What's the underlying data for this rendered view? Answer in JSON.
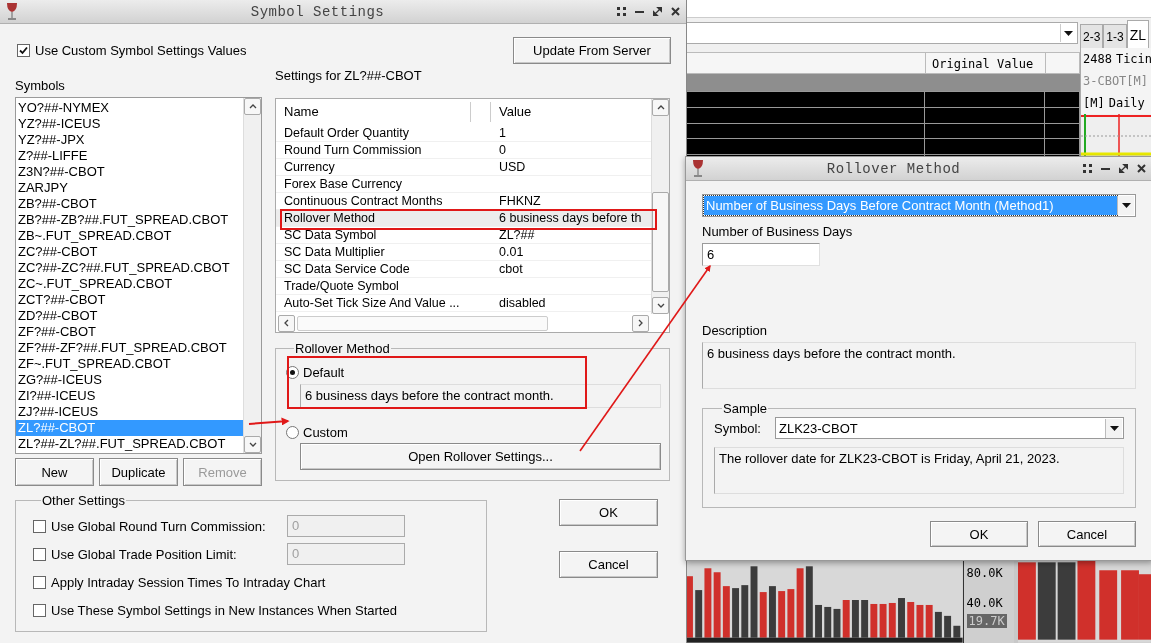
{
  "backdrop": {
    "tabs": [
      {
        "label": "2-3",
        "selected": false
      },
      {
        "label": "1-3",
        "selected": false
      },
      {
        "label": "ZL",
        "selected": true
      }
    ],
    "table": {
      "columns": [
        "Original Value"
      ]
    },
    "chart_header": [
      "2488",
      "Ticin"
    ],
    "chart_title": "3-CBOT[M]",
    "chart_labels": [
      "[M]",
      "Daily"
    ],
    "volume_axis": [
      "80.0K",
      "40.0K"
    ],
    "volume_readout": "19.7K"
  },
  "symbol_settings": {
    "title": "Symbol Settings",
    "use_custom": {
      "label": "Use Custom Symbol Settings Values",
      "checked": true
    },
    "update_button": "Update From Server",
    "symbols_label": "Symbols",
    "symbols": [
      {
        "label": "YO?##-NYMEX",
        "selected": false
      },
      {
        "label": "YZ?##-ICEUS",
        "selected": false
      },
      {
        "label": "YZ?##-JPX",
        "selected": false
      },
      {
        "label": "Z?##-LIFFE",
        "selected": false
      },
      {
        "label": "Z3N?##-CBOT",
        "selected": false
      },
      {
        "label": "ZARJPY",
        "selected": false
      },
      {
        "label": "ZB?##-CBOT",
        "selected": false
      },
      {
        "label": "ZB?##-ZB?##.FUT_SPREAD.CBOT",
        "selected": false
      },
      {
        "label": "ZB~.FUT_SPREAD.CBOT",
        "selected": false
      },
      {
        "label": "ZC?##-CBOT",
        "selected": false
      },
      {
        "label": "ZC?##-ZC?##.FUT_SPREAD.CBOT",
        "selected": false
      },
      {
        "label": "ZC~.FUT_SPREAD.CBOT",
        "selected": false
      },
      {
        "label": "ZCT?##-CBOT",
        "selected": false
      },
      {
        "label": "ZD?##-CBOT",
        "selected": false
      },
      {
        "label": "ZF?##-CBOT",
        "selected": false
      },
      {
        "label": "ZF?##-ZF?##.FUT_SPREAD.CBOT",
        "selected": false
      },
      {
        "label": "ZF~.FUT_SPREAD.CBOT",
        "selected": false
      },
      {
        "label": "ZG?##-ICEUS",
        "selected": false
      },
      {
        "label": "ZI?##-ICEUS",
        "selected": false
      },
      {
        "label": "ZJ?##-ICEUS",
        "selected": false
      },
      {
        "label": "ZL?##-CBOT",
        "selected": true
      },
      {
        "label": "ZL?##-ZL?##.FUT_SPREAD.CBOT",
        "selected": false
      }
    ],
    "list_buttons": [
      {
        "label": "New",
        "disabled": false
      },
      {
        "label": "Duplicate",
        "disabled": false
      },
      {
        "label": "Remove",
        "disabled": true
      }
    ],
    "settings_title": "Settings for ZL?##-CBOT",
    "settings_table": {
      "columns": [
        "Name",
        "Value"
      ],
      "rows": [
        {
          "name": "Default Order Quantity",
          "value": "1",
          "selected": false
        },
        {
          "name": "Round Turn Commission",
          "value": "0",
          "selected": false
        },
        {
          "name": "Currency",
          "value": "USD",
          "selected": false
        },
        {
          "name": "Forex Base Currency",
          "selected": false
        },
        {
          "name": "Continuous Contract Months",
          "value": "FHKNZ",
          "selected": false
        },
        {
          "name": "Rollover Method",
          "value": "6 business days before th",
          "selected": true
        },
        {
          "name": "SC Data Symbol",
          "value": "ZL?##",
          "selected": false
        },
        {
          "name": "SC Data Multiplier",
          "value": "0.01",
          "selected": false
        },
        {
          "name": "SC Data Service Code",
          "value": "cbot",
          "selected": false
        },
        {
          "name": "Trade/Quote Symbol",
          "selected": false
        },
        {
          "name": "Auto-Set Tick Size And Value ...",
          "value": "disabled",
          "selected": false
        }
      ]
    },
    "rollover_group": {
      "title": "Rollover Method",
      "options": [
        {
          "label": "Default",
          "selected": true,
          "description": "6 business days before the contract month."
        },
        {
          "label": "Custom",
          "selected": false
        }
      ],
      "open_button": "Open Rollover Settings..."
    },
    "other_settings": {
      "title": "Other Settings",
      "options": [
        {
          "label": "Use Global Round Turn Commission:",
          "checked": false,
          "field": {
            "value": "0",
            "disabled": true
          }
        },
        {
          "label": "Use Global Trade Position Limit:",
          "checked": false,
          "field": {
            "value": "0",
            "disabled": true
          }
        },
        {
          "label": "Apply Intraday Session Times To Intraday Chart",
          "checked": false
        },
        {
          "label": "Use These Symbol Settings in New Instances When Started",
          "checked": false
        }
      ]
    },
    "buttons": [
      "OK",
      "Cancel"
    ]
  },
  "rollover_dialog": {
    "title": "Rollover Method",
    "method": {
      "value": "Number of Business Days Before Contract Month (Method1)",
      "text_selected": true
    },
    "days_label": "Number of Business Days",
    "days_value": "6",
    "description_label": "Description",
    "description": "6 business days before the contract month.",
    "sample": {
      "title": "Sample",
      "symbol_label": "Symbol:",
      "symbol": "ZLK23-CBOT",
      "result": "The rollover date for ZLK23-CBOT is Friday, April 21, 2023."
    },
    "buttons": [
      "OK",
      "Cancel"
    ]
  }
}
